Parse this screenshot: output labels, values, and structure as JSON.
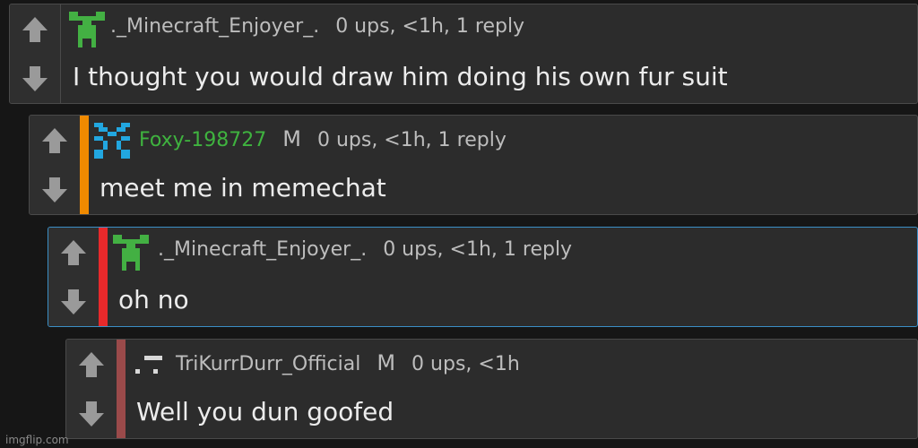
{
  "comments": [
    {
      "username": "._Minecraft_Enjoyer_.",
      "mod_tag": "",
      "stats": "0 ups, <1h, 1 reply",
      "text": "I thought you would draw him doing his own fur suit",
      "avatar_icon": "creeper-avatar-icon",
      "stripe_color": ""
    },
    {
      "username": "Foxy-198727",
      "mod_tag": "M",
      "stats": "0 ups, <1h, 1 reply",
      "text": "meet me in memechat",
      "avatar_icon": "blue-pixel-avatar-icon",
      "stripe_color": "#f08a00"
    },
    {
      "username": "._Minecraft_Enjoyer_.",
      "mod_tag": "",
      "stats": "0 ups, <1h, 1 reply",
      "text": "oh no",
      "avatar_icon": "creeper-avatar-icon",
      "stripe_color": "#e8292b"
    },
    {
      "username": "TriKurrDurr_Official",
      "mod_tag": "M",
      "stats": "0 ups, <1h",
      "text": "Well you dun goofed",
      "avatar_icon": "white-pixel-avatar-icon",
      "stripe_color": "#9a4a4a"
    }
  ],
  "watermark": "imgflip.com",
  "colors": {
    "background": "#161616",
    "card": "#2c2c2c",
    "highlight_border": "#3b8fc6",
    "username_green": "#3fb33f"
  }
}
